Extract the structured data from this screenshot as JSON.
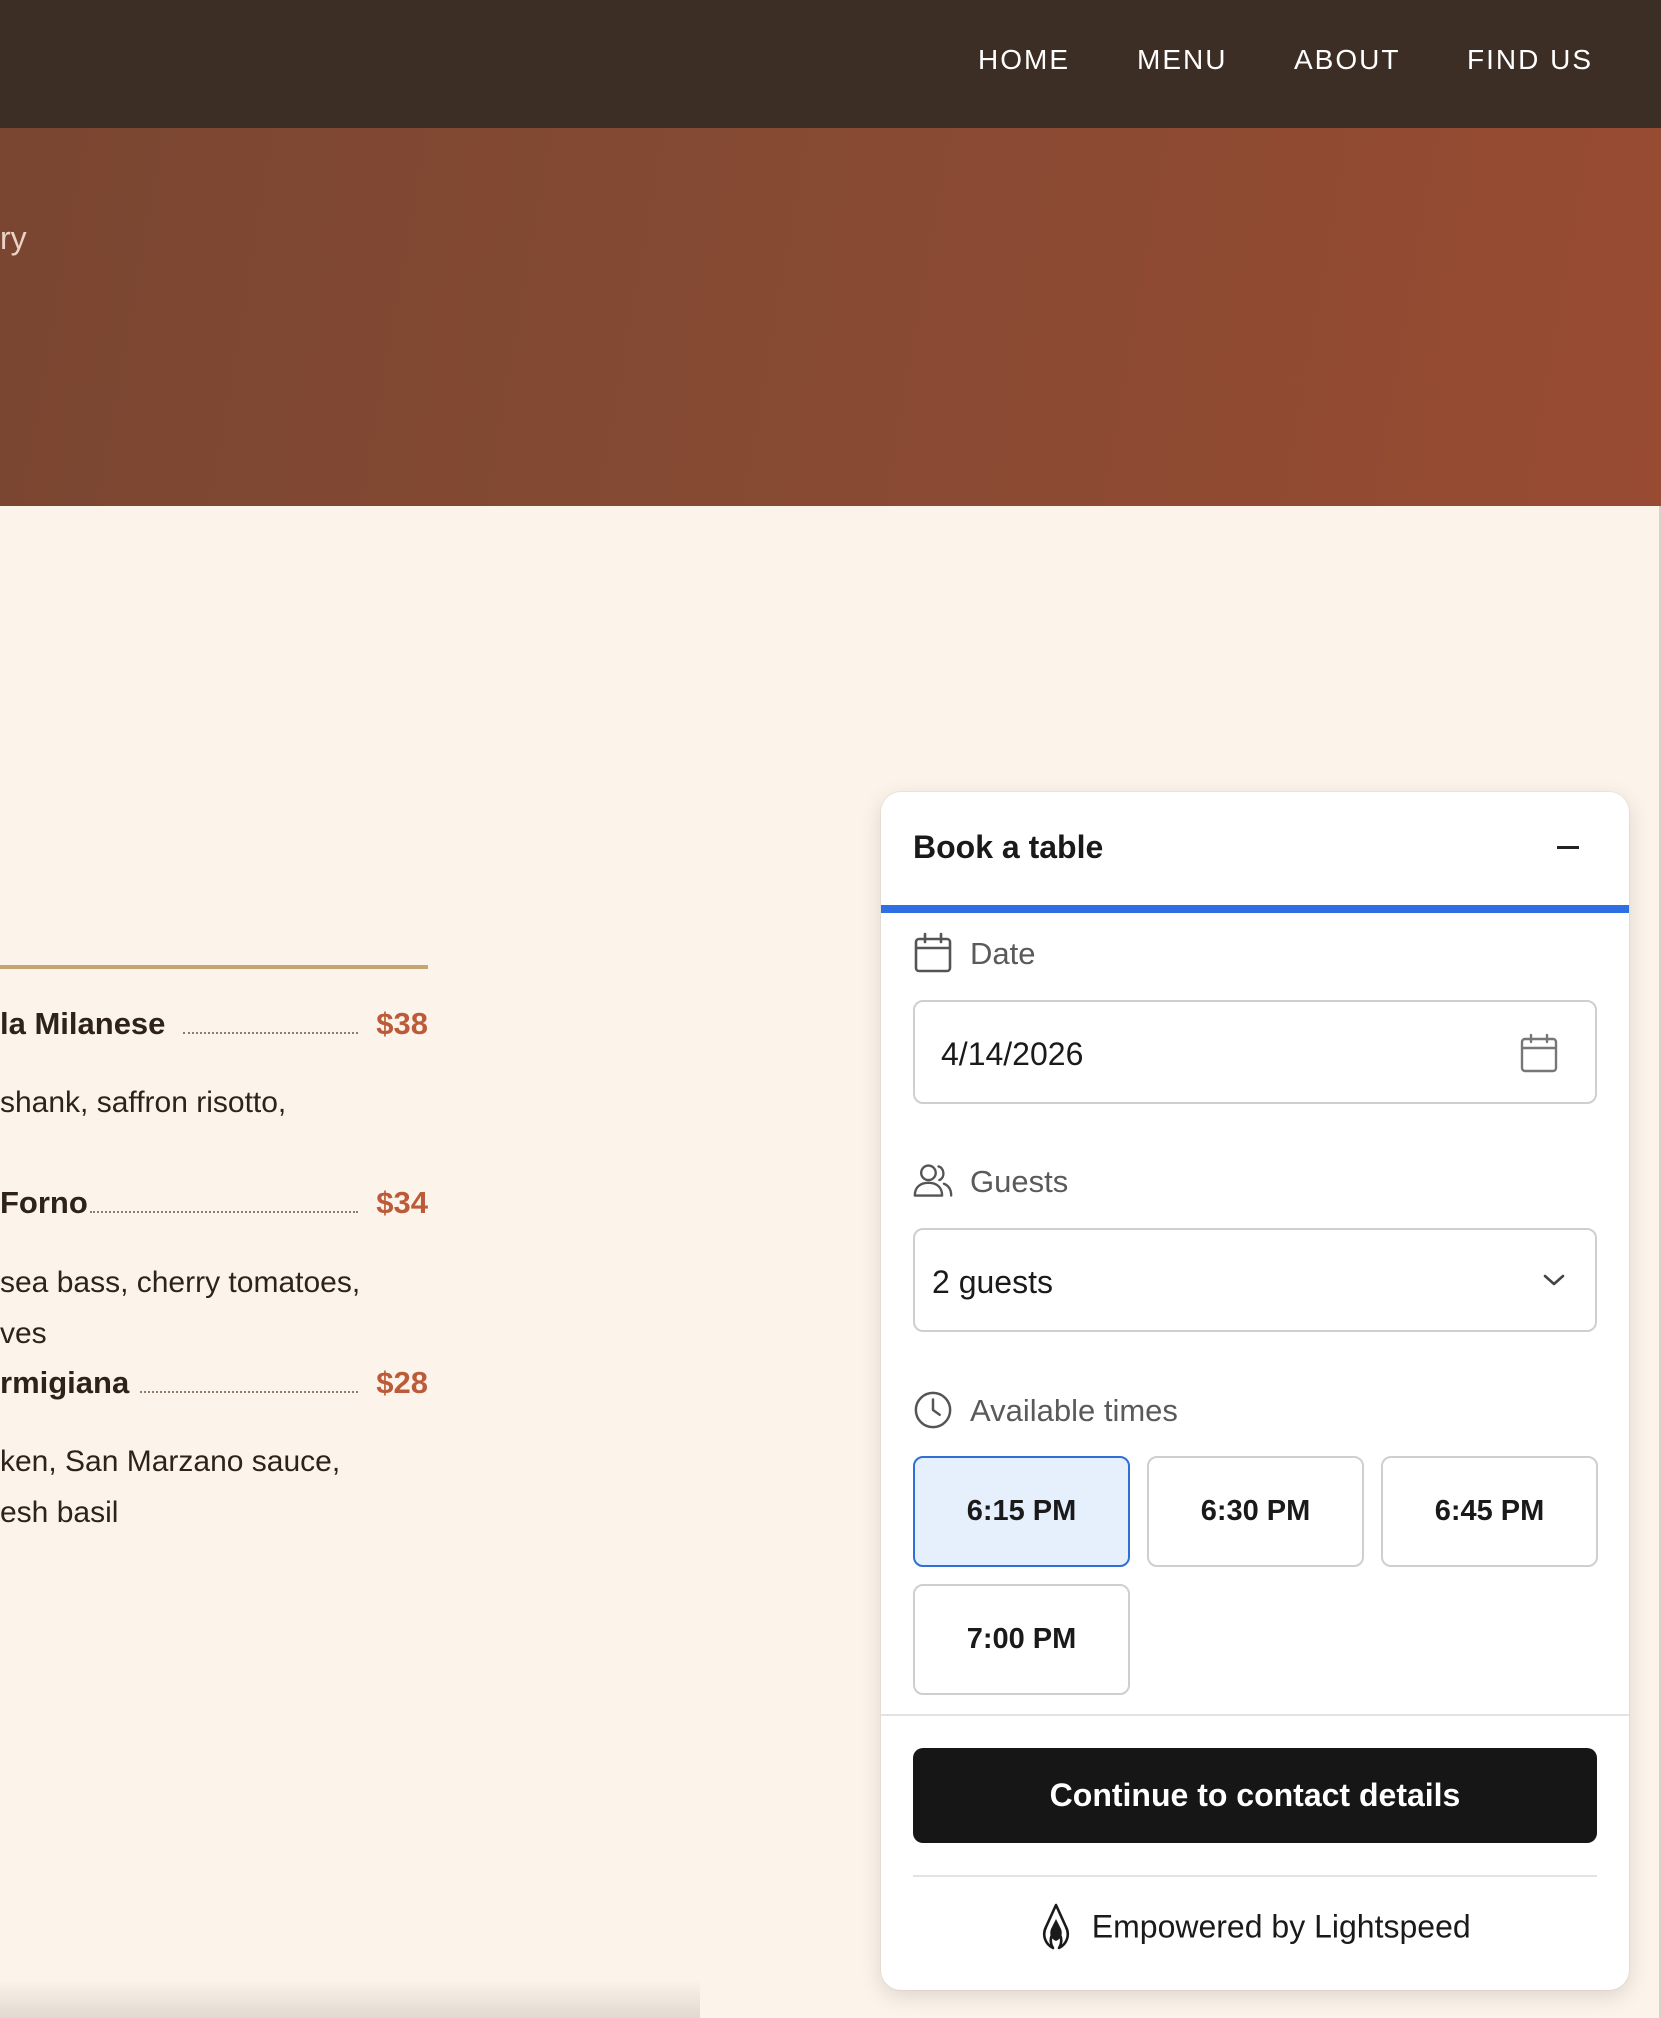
{
  "nav": {
    "items": [
      {
        "label": "HOME"
      },
      {
        "label": "MENU"
      },
      {
        "label": "ABOUT"
      },
      {
        "label": "FIND US"
      }
    ]
  },
  "hero": {
    "text_fragment": "ry"
  },
  "menu": {
    "items": [
      {
        "name": "la Milanese",
        "price": "$38",
        "description_lines": [
          "shank, saffron risotto,"
        ]
      },
      {
        "name": "Forno",
        "price": "$34",
        "description_lines": [
          " sea bass, cherry tomatoes,",
          "ves"
        ]
      },
      {
        "name": "rmigiana",
        "price": "$28",
        "description_lines": [
          "ken, San Marzano sauce,",
          "esh basil"
        ]
      }
    ]
  },
  "booking": {
    "title": "Book a table",
    "progress_fraction": 1.0,
    "date": {
      "label": "Date",
      "value": "4/14/2026"
    },
    "guests": {
      "label": "Guests",
      "value": "2 guests"
    },
    "times": {
      "label": "Available times",
      "options": [
        "6:15 PM",
        "6:30 PM",
        "6:45 PM",
        "7:00 PM"
      ],
      "selected": "6:15 PM"
    },
    "continue_label": "Continue to contact details",
    "powered_by": "Empowered by Lightspeed"
  },
  "colors": {
    "nav_bg": "#3d2e25",
    "page_bg": "#fcf4ea",
    "price": "#bb5b3a",
    "accent_blue": "#2f6fe4",
    "selected_bg": "#e6f0fd",
    "button_dark": "#161616"
  },
  "icons": [
    "calendar-icon",
    "users-icon",
    "clock-icon",
    "chevron-down-icon",
    "minus-icon",
    "lightspeed-logo-icon"
  ]
}
